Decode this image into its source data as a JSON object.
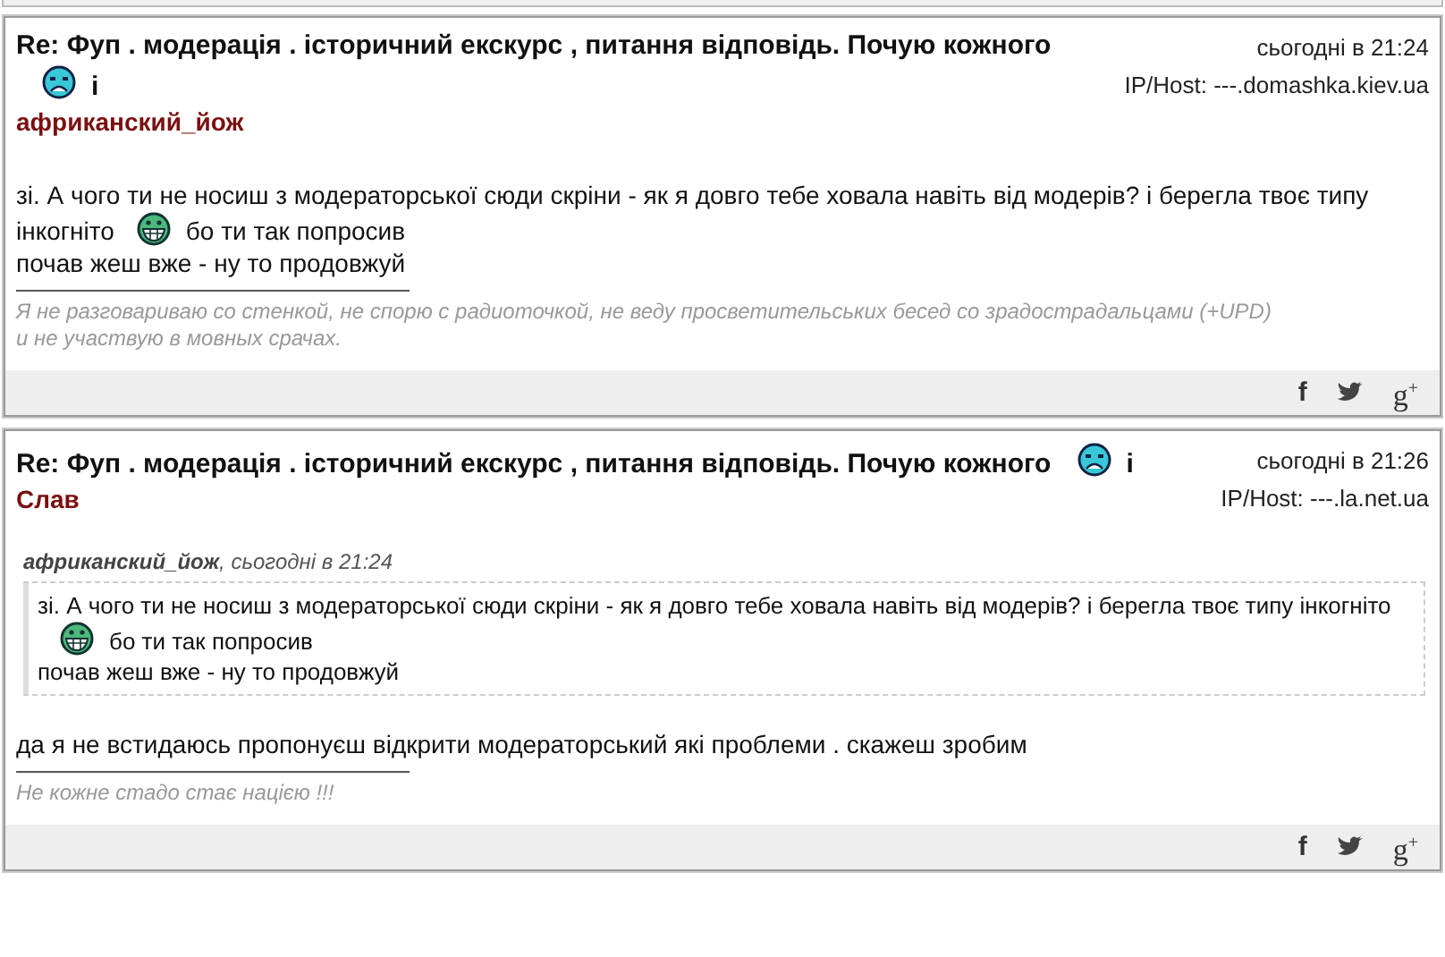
{
  "posts": [
    {
      "title": [
        {
          "kind": "text",
          "text": "Re: Фуп . модерація . історичний екскурс , питання відповідь. Почую кожного"
        },
        {
          "kind": "sad"
        },
        {
          "kind": "text",
          "text": "і"
        }
      ],
      "author": "африканский_йож",
      "date": "сьогодні в 21:24",
      "host": "IP/Host: ---.domashka.kiev.ua",
      "body": [
        {
          "kind": "text",
          "text": "зі. А чого ти не носиш з модераторської сюди скріни - як я довго тебе ховала навіть від модерів? і берегла твоє типу інкогніто"
        },
        {
          "kind": "grin"
        },
        {
          "kind": "text",
          "text": "бо ти так попросив"
        },
        {
          "kind": "break"
        },
        {
          "kind": "text",
          "text": "почав жеш вже - ну то продовжуй"
        }
      ],
      "signature": [
        "Я не разговариваю со стенкой, не спорю с радиоточкой, не веду просветительських бесед со зрадострадальцами  (+UPD)",
        "и не участвую в мовных срачах."
      ],
      "share": [
        {
          "kind": "facebook",
          "label": "f"
        },
        {
          "kind": "twitter"
        },
        {
          "kind": "google",
          "label": "g$^{+}$"
        }
      ]
    },
    {
      "title": [
        {
          "kind": "text",
          "text": "Re: Фуп . модерація . історичний екскурс , питання відповідь. Почую кожного"
        },
        {
          "kind": "sad"
        },
        {
          "kind": "text",
          "text": "і"
        }
      ],
      "author": "Слав",
      "date": "сьогодні в 21:26",
      "host": "IP/Host: ---.la.net.ua",
      "quote": {
        "author": "африканский_йож",
        "date": ", сьогодні в 21:24",
        "body": [
          {
            "kind": "text",
            "text": "зі. А чого ти не носиш з модераторської сюди скріни - як я довго тебе ховала навіть від модерів? і берегла твоє типу інкогніто"
          },
          {
            "kind": "grin"
          },
          {
            "kind": "text",
            "text": "бо ти так попросив"
          },
          {
            "kind": "break"
          },
          {
            "kind": "text",
            "text": "почав жеш вже - ну то продовжуй"
          }
        ]
      },
      "body": [
        {
          "kind": "text",
          "text": "да я не встидаюсь пропонуєш відкрити модераторський які проблеми . скажеш зробим"
        }
      ],
      "signature": [
        "Не кожне стадо стає нацією !!!"
      ],
      "share": [
        {
          "kind": "facebook",
          "label": "f"
        },
        {
          "kind": "twitter"
        },
        {
          "kind": "google",
          "label": "g$^{+}$"
        }
      ]
    }
  ]
}
